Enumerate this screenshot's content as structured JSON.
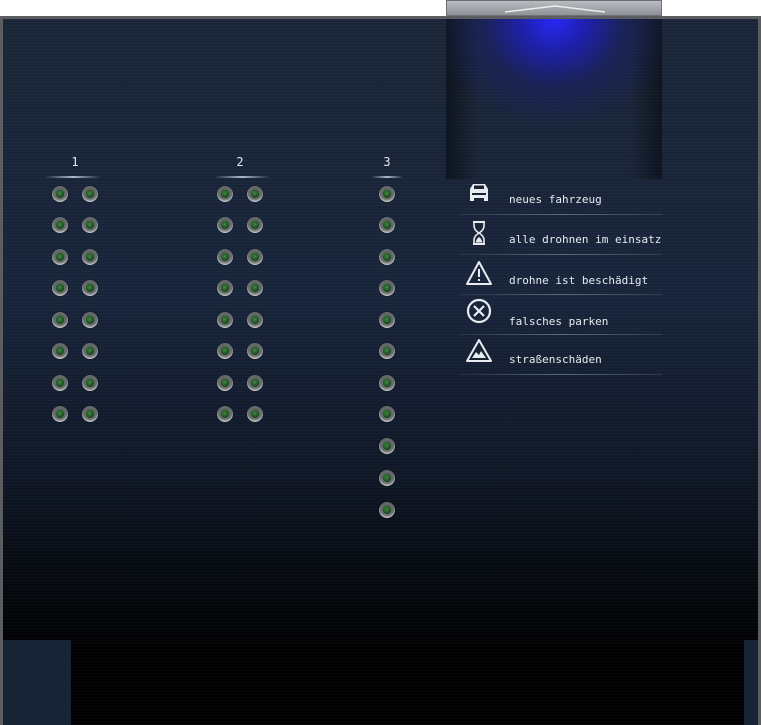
{
  "groups": [
    {
      "label": "1",
      "led_rows": 8,
      "led_cols": 2
    },
    {
      "label": "2",
      "led_rows": 8,
      "led_cols": 2
    },
    {
      "label": "3",
      "led_rows": 11,
      "led_cols": 1
    }
  ],
  "legend": [
    {
      "icon": "car-icon",
      "label": "neues fahrzeug"
    },
    {
      "icon": "hourglass-icon",
      "label": "alle drohnen im einsatz"
    },
    {
      "icon": "warning-icon",
      "label": "drohne ist beschädigt"
    },
    {
      "icon": "no-entry-icon",
      "label": "falsches parken"
    },
    {
      "icon": "road-damage-icon",
      "label": "straßenschäden"
    }
  ],
  "colors": {
    "panel_bg": "#18243a",
    "accent_light": "#2828ff",
    "led_green": "#3f8a3f",
    "text": "#e8ebf0"
  }
}
